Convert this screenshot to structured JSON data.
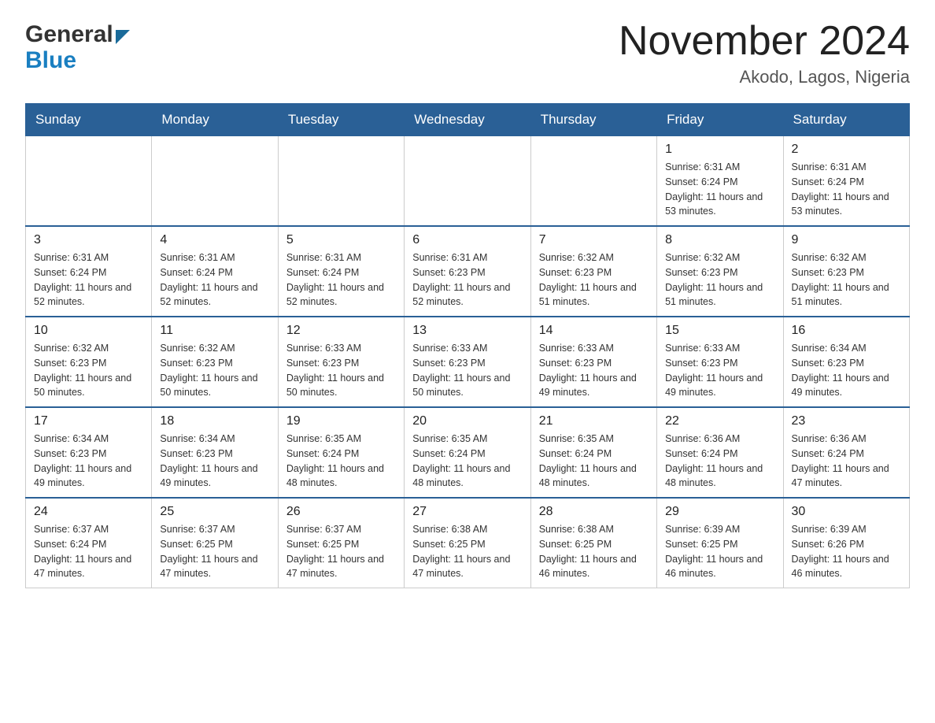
{
  "logo": {
    "general": "General",
    "blue": "Blue"
  },
  "header": {
    "title": "November 2024",
    "subtitle": "Akodo, Lagos, Nigeria"
  },
  "calendar": {
    "days_of_week": [
      "Sunday",
      "Monday",
      "Tuesday",
      "Wednesday",
      "Thursday",
      "Friday",
      "Saturday"
    ],
    "weeks": [
      {
        "days": [
          {
            "number": "",
            "info": ""
          },
          {
            "number": "",
            "info": ""
          },
          {
            "number": "",
            "info": ""
          },
          {
            "number": "",
            "info": ""
          },
          {
            "number": "",
            "info": ""
          },
          {
            "number": "1",
            "info": "Sunrise: 6:31 AM\nSunset: 6:24 PM\nDaylight: 11 hours and 53 minutes."
          },
          {
            "number": "2",
            "info": "Sunrise: 6:31 AM\nSunset: 6:24 PM\nDaylight: 11 hours and 53 minutes."
          }
        ]
      },
      {
        "days": [
          {
            "number": "3",
            "info": "Sunrise: 6:31 AM\nSunset: 6:24 PM\nDaylight: 11 hours and 52 minutes."
          },
          {
            "number": "4",
            "info": "Sunrise: 6:31 AM\nSunset: 6:24 PM\nDaylight: 11 hours and 52 minutes."
          },
          {
            "number": "5",
            "info": "Sunrise: 6:31 AM\nSunset: 6:24 PM\nDaylight: 11 hours and 52 minutes."
          },
          {
            "number": "6",
            "info": "Sunrise: 6:31 AM\nSunset: 6:23 PM\nDaylight: 11 hours and 52 minutes."
          },
          {
            "number": "7",
            "info": "Sunrise: 6:32 AM\nSunset: 6:23 PM\nDaylight: 11 hours and 51 minutes."
          },
          {
            "number": "8",
            "info": "Sunrise: 6:32 AM\nSunset: 6:23 PM\nDaylight: 11 hours and 51 minutes."
          },
          {
            "number": "9",
            "info": "Sunrise: 6:32 AM\nSunset: 6:23 PM\nDaylight: 11 hours and 51 minutes."
          }
        ]
      },
      {
        "days": [
          {
            "number": "10",
            "info": "Sunrise: 6:32 AM\nSunset: 6:23 PM\nDaylight: 11 hours and 50 minutes."
          },
          {
            "number": "11",
            "info": "Sunrise: 6:32 AM\nSunset: 6:23 PM\nDaylight: 11 hours and 50 minutes."
          },
          {
            "number": "12",
            "info": "Sunrise: 6:33 AM\nSunset: 6:23 PM\nDaylight: 11 hours and 50 minutes."
          },
          {
            "number": "13",
            "info": "Sunrise: 6:33 AM\nSunset: 6:23 PM\nDaylight: 11 hours and 50 minutes."
          },
          {
            "number": "14",
            "info": "Sunrise: 6:33 AM\nSunset: 6:23 PM\nDaylight: 11 hours and 49 minutes."
          },
          {
            "number": "15",
            "info": "Sunrise: 6:33 AM\nSunset: 6:23 PM\nDaylight: 11 hours and 49 minutes."
          },
          {
            "number": "16",
            "info": "Sunrise: 6:34 AM\nSunset: 6:23 PM\nDaylight: 11 hours and 49 minutes."
          }
        ]
      },
      {
        "days": [
          {
            "number": "17",
            "info": "Sunrise: 6:34 AM\nSunset: 6:23 PM\nDaylight: 11 hours and 49 minutes."
          },
          {
            "number": "18",
            "info": "Sunrise: 6:34 AM\nSunset: 6:23 PM\nDaylight: 11 hours and 49 minutes."
          },
          {
            "number": "19",
            "info": "Sunrise: 6:35 AM\nSunset: 6:24 PM\nDaylight: 11 hours and 48 minutes."
          },
          {
            "number": "20",
            "info": "Sunrise: 6:35 AM\nSunset: 6:24 PM\nDaylight: 11 hours and 48 minutes."
          },
          {
            "number": "21",
            "info": "Sunrise: 6:35 AM\nSunset: 6:24 PM\nDaylight: 11 hours and 48 minutes."
          },
          {
            "number": "22",
            "info": "Sunrise: 6:36 AM\nSunset: 6:24 PM\nDaylight: 11 hours and 48 minutes."
          },
          {
            "number": "23",
            "info": "Sunrise: 6:36 AM\nSunset: 6:24 PM\nDaylight: 11 hours and 47 minutes."
          }
        ]
      },
      {
        "days": [
          {
            "number": "24",
            "info": "Sunrise: 6:37 AM\nSunset: 6:24 PM\nDaylight: 11 hours and 47 minutes."
          },
          {
            "number": "25",
            "info": "Sunrise: 6:37 AM\nSunset: 6:25 PM\nDaylight: 11 hours and 47 minutes."
          },
          {
            "number": "26",
            "info": "Sunrise: 6:37 AM\nSunset: 6:25 PM\nDaylight: 11 hours and 47 minutes."
          },
          {
            "number": "27",
            "info": "Sunrise: 6:38 AM\nSunset: 6:25 PM\nDaylight: 11 hours and 47 minutes."
          },
          {
            "number": "28",
            "info": "Sunrise: 6:38 AM\nSunset: 6:25 PM\nDaylight: 11 hours and 46 minutes."
          },
          {
            "number": "29",
            "info": "Sunrise: 6:39 AM\nSunset: 6:25 PM\nDaylight: 11 hours and 46 minutes."
          },
          {
            "number": "30",
            "info": "Sunrise: 6:39 AM\nSunset: 6:26 PM\nDaylight: 11 hours and 46 minutes."
          }
        ]
      }
    ]
  }
}
